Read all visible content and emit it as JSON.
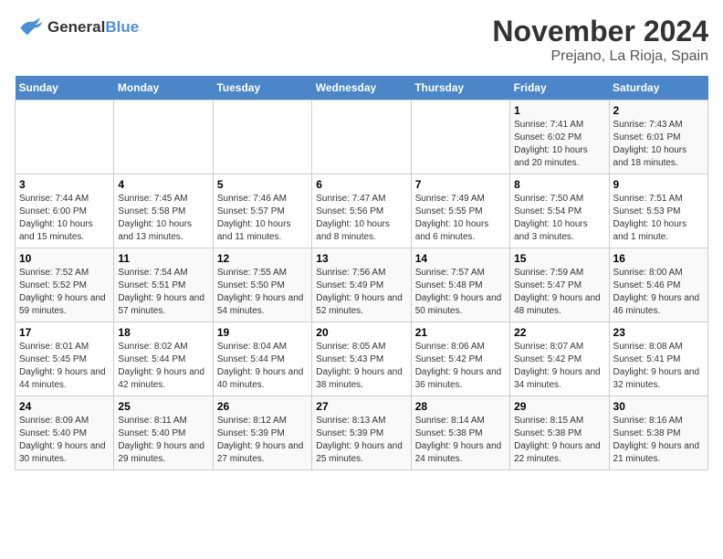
{
  "logo": {
    "line1": "General",
    "line2": "Blue"
  },
  "title": "November 2024",
  "location": "Prejano, La Rioja, Spain",
  "days_of_week": [
    "Sunday",
    "Monday",
    "Tuesday",
    "Wednesday",
    "Thursday",
    "Friday",
    "Saturday"
  ],
  "weeks": [
    [
      {
        "day": "",
        "info": ""
      },
      {
        "day": "",
        "info": ""
      },
      {
        "day": "",
        "info": ""
      },
      {
        "day": "",
        "info": ""
      },
      {
        "day": "",
        "info": ""
      },
      {
        "day": "1",
        "info": "Sunrise: 7:41 AM\nSunset: 6:02 PM\nDaylight: 10 hours and 20 minutes."
      },
      {
        "day": "2",
        "info": "Sunrise: 7:43 AM\nSunset: 6:01 PM\nDaylight: 10 hours and 18 minutes."
      }
    ],
    [
      {
        "day": "3",
        "info": "Sunrise: 7:44 AM\nSunset: 6:00 PM\nDaylight: 10 hours and 15 minutes."
      },
      {
        "day": "4",
        "info": "Sunrise: 7:45 AM\nSunset: 5:58 PM\nDaylight: 10 hours and 13 minutes."
      },
      {
        "day": "5",
        "info": "Sunrise: 7:46 AM\nSunset: 5:57 PM\nDaylight: 10 hours and 11 minutes."
      },
      {
        "day": "6",
        "info": "Sunrise: 7:47 AM\nSunset: 5:56 PM\nDaylight: 10 hours and 8 minutes."
      },
      {
        "day": "7",
        "info": "Sunrise: 7:49 AM\nSunset: 5:55 PM\nDaylight: 10 hours and 6 minutes."
      },
      {
        "day": "8",
        "info": "Sunrise: 7:50 AM\nSunset: 5:54 PM\nDaylight: 10 hours and 3 minutes."
      },
      {
        "day": "9",
        "info": "Sunrise: 7:51 AM\nSunset: 5:53 PM\nDaylight: 10 hours and 1 minute."
      }
    ],
    [
      {
        "day": "10",
        "info": "Sunrise: 7:52 AM\nSunset: 5:52 PM\nDaylight: 9 hours and 59 minutes."
      },
      {
        "day": "11",
        "info": "Sunrise: 7:54 AM\nSunset: 5:51 PM\nDaylight: 9 hours and 57 minutes."
      },
      {
        "day": "12",
        "info": "Sunrise: 7:55 AM\nSunset: 5:50 PM\nDaylight: 9 hours and 54 minutes."
      },
      {
        "day": "13",
        "info": "Sunrise: 7:56 AM\nSunset: 5:49 PM\nDaylight: 9 hours and 52 minutes."
      },
      {
        "day": "14",
        "info": "Sunrise: 7:57 AM\nSunset: 5:48 PM\nDaylight: 9 hours and 50 minutes."
      },
      {
        "day": "15",
        "info": "Sunrise: 7:59 AM\nSunset: 5:47 PM\nDaylight: 9 hours and 48 minutes."
      },
      {
        "day": "16",
        "info": "Sunrise: 8:00 AM\nSunset: 5:46 PM\nDaylight: 9 hours and 46 minutes."
      }
    ],
    [
      {
        "day": "17",
        "info": "Sunrise: 8:01 AM\nSunset: 5:45 PM\nDaylight: 9 hours and 44 minutes."
      },
      {
        "day": "18",
        "info": "Sunrise: 8:02 AM\nSunset: 5:44 PM\nDaylight: 9 hours and 42 minutes."
      },
      {
        "day": "19",
        "info": "Sunrise: 8:04 AM\nSunset: 5:44 PM\nDaylight: 9 hours and 40 minutes."
      },
      {
        "day": "20",
        "info": "Sunrise: 8:05 AM\nSunset: 5:43 PM\nDaylight: 9 hours and 38 minutes."
      },
      {
        "day": "21",
        "info": "Sunrise: 8:06 AM\nSunset: 5:42 PM\nDaylight: 9 hours and 36 minutes."
      },
      {
        "day": "22",
        "info": "Sunrise: 8:07 AM\nSunset: 5:42 PM\nDaylight: 9 hours and 34 minutes."
      },
      {
        "day": "23",
        "info": "Sunrise: 8:08 AM\nSunset: 5:41 PM\nDaylight: 9 hours and 32 minutes."
      }
    ],
    [
      {
        "day": "24",
        "info": "Sunrise: 8:09 AM\nSunset: 5:40 PM\nDaylight: 9 hours and 30 minutes."
      },
      {
        "day": "25",
        "info": "Sunrise: 8:11 AM\nSunset: 5:40 PM\nDaylight: 9 hours and 29 minutes."
      },
      {
        "day": "26",
        "info": "Sunrise: 8:12 AM\nSunset: 5:39 PM\nDaylight: 9 hours and 27 minutes."
      },
      {
        "day": "27",
        "info": "Sunrise: 8:13 AM\nSunset: 5:39 PM\nDaylight: 9 hours and 25 minutes."
      },
      {
        "day": "28",
        "info": "Sunrise: 8:14 AM\nSunset: 5:38 PM\nDaylight: 9 hours and 24 minutes."
      },
      {
        "day": "29",
        "info": "Sunrise: 8:15 AM\nSunset: 5:38 PM\nDaylight: 9 hours and 22 minutes."
      },
      {
        "day": "30",
        "info": "Sunrise: 8:16 AM\nSunset: 5:38 PM\nDaylight: 9 hours and 21 minutes."
      }
    ]
  ]
}
